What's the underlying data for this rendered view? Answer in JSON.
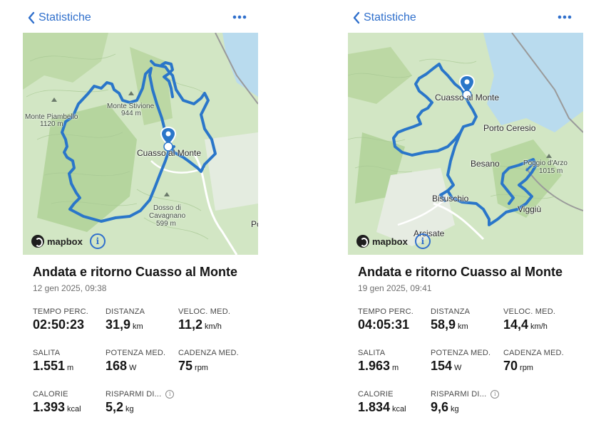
{
  "screens": [
    {
      "nav": {
        "back_label": "Statistiche"
      },
      "map": {
        "labels": [
          {
            "text": "Monte Piambello",
            "kind": "peak"
          },
          {
            "text": "1120 m",
            "kind": "elev"
          },
          {
            "text": "Monte Stivione",
            "kind": "peak"
          },
          {
            "text": "944 m",
            "kind": "elev"
          },
          {
            "text": "Cuasso al Monte",
            "kind": "town"
          },
          {
            "text": "Dosso di",
            "kind": "peak"
          },
          {
            "text": "Cavagnano",
            "kind": "peak"
          },
          {
            "text": "599 m",
            "kind": "elev"
          },
          {
            "text": "Po",
            "kind": "town"
          }
        ],
        "attribution": "mapbox"
      },
      "activity": {
        "title": "Andata e ritorno Cuasso al Monte",
        "date": "12 gen 2025, 09:38"
      },
      "stats": [
        {
          "label": "TEMPO PERC.",
          "value": "02:50:23",
          "unit": ""
        },
        {
          "label": "DISTANZA",
          "value": "31,9",
          "unit": "km"
        },
        {
          "label": "VELOC. MED.",
          "value": "11,2",
          "unit": "km/h"
        },
        {
          "label": "SALITA",
          "value": "1.551",
          "unit": "m"
        },
        {
          "label": "POTENZA MED.",
          "value": "168",
          "unit": "W"
        },
        {
          "label": "CADENZA MED.",
          "value": "75",
          "unit": "rpm"
        },
        {
          "label": "CALORIE",
          "value": "1.393",
          "unit": "kcal"
        },
        {
          "label": "RISPARMI DI...",
          "value": "5,2",
          "unit": "kg"
        }
      ]
    },
    {
      "nav": {
        "back_label": "Statistiche"
      },
      "map": {
        "labels": [
          {
            "text": "Cuasso al Monte",
            "kind": "town"
          },
          {
            "text": "Porto Ceresio",
            "kind": "town"
          },
          {
            "text": "Besano",
            "kind": "town"
          },
          {
            "text": "Poggio d'Arzo",
            "kind": "peak"
          },
          {
            "text": "1015 m",
            "kind": "elev"
          },
          {
            "text": "Bisuschio",
            "kind": "town"
          },
          {
            "text": "Viggiù",
            "kind": "town"
          },
          {
            "text": "Arcisate",
            "kind": "town"
          }
        ],
        "attribution": "mapbox"
      },
      "activity": {
        "title": "Andata e ritorno Cuasso al Monte",
        "date": "19 gen 2025, 09:41"
      },
      "stats": [
        {
          "label": "TEMPO PERC.",
          "value": "04:05:31",
          "unit": ""
        },
        {
          "label": "DISTANZA",
          "value": "58,9",
          "unit": "km"
        },
        {
          "label": "VELOC. MED.",
          "value": "14,4",
          "unit": "km/h"
        },
        {
          "label": "SALITA",
          "value": "1.963",
          "unit": "m"
        },
        {
          "label": "POTENZA MED.",
          "value": "154",
          "unit": "W"
        },
        {
          "label": "CADENZA MED.",
          "value": "70",
          "unit": "rpm"
        },
        {
          "label": "CALORIE",
          "value": "1.834",
          "unit": "kcal"
        },
        {
          "label": "RISPARMI DI...",
          "value": "9,6",
          "unit": "kg"
        }
      ]
    }
  ],
  "colors": {
    "accent": "#2f6fcc",
    "route": "#2a76c9",
    "terrain": "#cfe3bf",
    "forest": "#b7d6a0",
    "lake": "#b9dbee"
  },
  "icons": {
    "back": "chevron-left-icon",
    "more": "ellipsis-icon",
    "info": "info-icon",
    "pin": "map-pin-icon"
  }
}
